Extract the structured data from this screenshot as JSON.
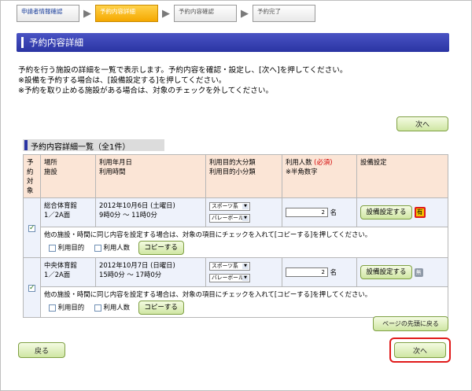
{
  "steps": [
    {
      "label": "申請者情報確認"
    },
    {
      "label": "予約内容詳細"
    },
    {
      "label": "予約内容確認"
    },
    {
      "label": "予約完了"
    }
  ],
  "page_title": "予約内容詳細",
  "intro": {
    "line1": "予約を行う施設の詳細を一覧で表示します。予約内容を確認・設定し、[次へ]を押してください。",
    "line2": "※設備を予約する場合は、[設備設定する]を押してください。",
    "line3": "※予約を取り止める施設がある場合は、対象のチェックを外してください。"
  },
  "buttons": {
    "next_top": "次へ",
    "page_top": "ページの先頭に戻る",
    "back": "戻る",
    "next_bottom": "次へ"
  },
  "section_title": "予約内容詳細一覧（全1件）",
  "table": {
    "headers": {
      "target1": "予約",
      "target2": "対象",
      "place1": "場所",
      "place2": "施設",
      "date1": "利用年月日",
      "date2": "利用時間",
      "purpose1": "利用目的大分類",
      "purpose2": "利用目的小分類",
      "people1": "利用人数",
      "people_req": "(必須)",
      "people2": "※半角数字",
      "equip": "設備設定"
    },
    "rows": [
      {
        "checked": true,
        "place": "総合体育館",
        "facility": "1／2A面",
        "date": "2012年10月6日 (土曜日)",
        "time": "9時0分 ～ 11時0分",
        "purpose_major": "スポーツ系",
        "purpose_minor": "バレーボール",
        "people": "2",
        "people_unit": "名",
        "equip_button": "設備設定する",
        "equip_status": "有",
        "copy_text": "他の施設・時間に同じ内容を設定する場合は、対象の項目にチェックを入れて[コピーする]を押してください。",
        "copy_opt1": "利用目的",
        "copy_opt2": "利用人数",
        "copy_button": "コピーする"
      },
      {
        "checked": true,
        "place": "中央体育館",
        "facility": "1／2A面",
        "date": "2012年10月7日 (日曜日)",
        "time": "15時0分 ～ 17時0分",
        "purpose_major": "スポーツ系",
        "purpose_minor": "バレーボール",
        "people": "2",
        "people_unit": "名",
        "equip_button": "設備設定する",
        "equip_status": "無",
        "copy_text": "他の施設・時間に同じ内容を設定する場合は、対象の項目にチェックを入れて[コピーする]を押してください。",
        "copy_opt1": "利用目的",
        "copy_opt2": "利用人数",
        "copy_button": "コピーする"
      }
    ]
  },
  "colors": {
    "title_bar": "#2a34a3",
    "active_step": "#f5a800",
    "highlight": "#e01a1a",
    "header_bg": "#fbe5d6",
    "row_bg": "#eef2fb"
  }
}
